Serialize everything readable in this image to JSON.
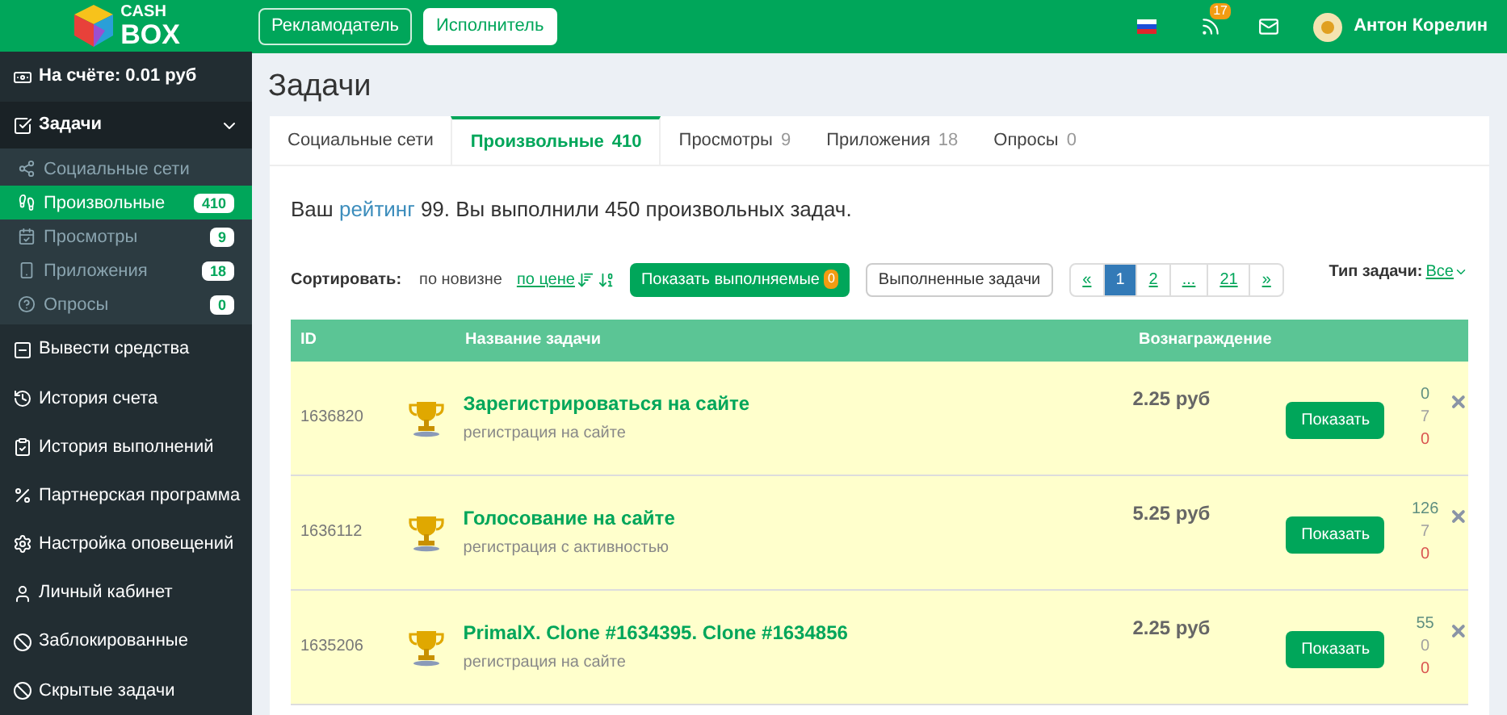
{
  "logo": {
    "line_1": "CASH",
    "line_2": "BOX"
  },
  "topbar": {
    "buttons": [
      {
        "label": "Рекламодатель",
        "selected": false
      },
      {
        "label": "Исполнитель",
        "selected": true
      }
    ],
    "notifications_badge": "17",
    "user_name": "Антон Корелин"
  },
  "sidebar": {
    "balance": "На счёте: 0.01 руб",
    "section": {
      "label": "Задачи",
      "expanded": true,
      "children": [
        {
          "label": "Социальные сети",
          "selected": false
        },
        {
          "label": "Произвольные",
          "count": "410",
          "selected": true
        },
        {
          "label": "Просмотры",
          "count": "9",
          "selected": false
        },
        {
          "label": "Приложения",
          "count": "18",
          "selected": false
        },
        {
          "label": "Опросы",
          "count": "0",
          "selected": false
        }
      ]
    },
    "items": [
      "Вывести средства",
      "История счета",
      "История выполнений",
      "Партнерская программа",
      "Настройка оповещений",
      "Личный кабинет",
      "Заблокированные",
      "Скрытые задачи"
    ]
  },
  "page_title": "Задачи",
  "tabs": [
    {
      "label": "Социальные сети",
      "selected": false
    },
    {
      "label": "Произвольные",
      "count": "410",
      "selected": true
    },
    {
      "label": "Просмотры",
      "count": "9",
      "selected": false
    },
    {
      "label": "Приложения",
      "count": "18",
      "selected": false
    },
    {
      "label": "Опросы",
      "count": "0",
      "selected": false
    }
  ],
  "rating": {
    "prefix": "Ваш",
    "link": "рейтинг",
    "suffix": "99. Вы выполнили 450 произвольных задач."
  },
  "toolbar": {
    "sort_label": "Сортировать:",
    "sort_options": [
      {
        "label": "по новизне",
        "selected": true
      },
      {
        "label": "по цене",
        "selected": false
      }
    ],
    "show_active_button": {
      "label": "Показать выполняемые",
      "badge": "0"
    },
    "done_button": "Выполненные задачи",
    "pagination": [
      {
        "label": "«",
        "selected": false
      },
      {
        "label": "1",
        "selected": true
      },
      {
        "label": "2",
        "selected": false
      },
      {
        "label": "...",
        "selected": false
      },
      {
        "label": "21",
        "selected": false
      },
      {
        "label": "»",
        "selected": false
      }
    ],
    "task_type_label": "Тип задачи:",
    "task_type_value": "Все"
  },
  "table": {
    "columns": [
      "ID",
      "Название задачи",
      "Вознаграждение"
    ],
    "rows": [
      {
        "id": "1636820",
        "title": "Зарегистрироваться на сайте",
        "subtitle": "регистрация на сайте",
        "reward": "2.25 руб",
        "button": "Показать",
        "stats": [
          {
            "value": "0",
            "color": "#5f8f80"
          },
          {
            "value": "7",
            "color": "#a0a0a0"
          },
          {
            "value": "0",
            "color": "#d9534f"
          }
        ]
      },
      {
        "id": "1636112",
        "title": "Голосование на сайте",
        "subtitle": "регистрация с активностью",
        "reward": "5.25 руб",
        "button": "Показать",
        "stats": [
          {
            "value": "126",
            "color": "#5f8f80"
          },
          {
            "value": "7",
            "color": "#a0a0a0"
          },
          {
            "value": "0",
            "color": "#d9534f"
          }
        ]
      },
      {
        "id": "1635206",
        "title": "PrimalX. Clone #1634395. Clone #1634856",
        "subtitle": "регистрация на сайте",
        "reward": "2.25 руб",
        "button": "Показать",
        "stats": [
          {
            "value": "55",
            "color": "#5f8f80"
          },
          {
            "value": "0",
            "color": "#a0a0a0"
          },
          {
            "value": "0",
            "color": "#d9534f"
          }
        ]
      }
    ]
  }
}
